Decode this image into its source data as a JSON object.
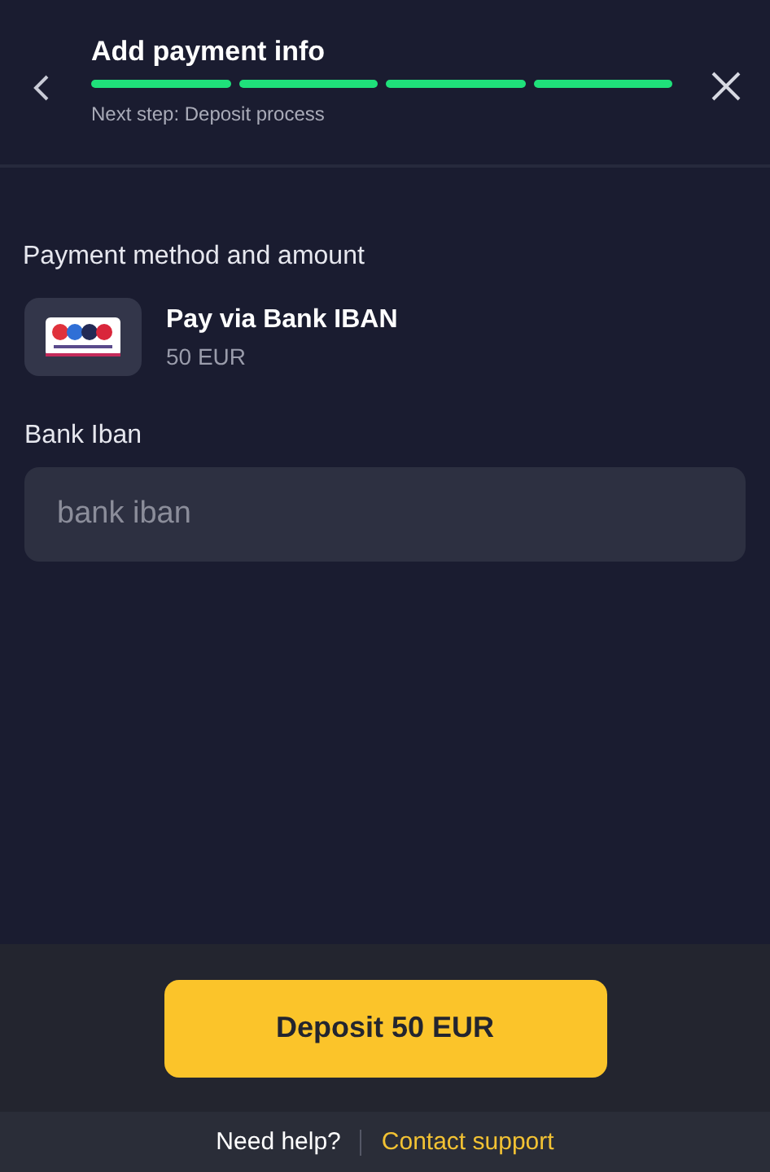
{
  "header": {
    "title": "Add payment info",
    "steps": [
      {
        "done": true
      },
      {
        "done": true
      },
      {
        "done": true
      },
      {
        "done": true
      }
    ],
    "subtitle": "Next step: Deposit process"
  },
  "section_title": "Payment method and amount",
  "method": {
    "name": "Pay via Bank IBAN",
    "amount": "50 EUR"
  },
  "field": {
    "label": "Bank Iban",
    "placeholder": "bank iban"
  },
  "deposit_button": "Deposit 50 EUR",
  "footer": {
    "help": "Need help?",
    "link": "Contact support"
  }
}
